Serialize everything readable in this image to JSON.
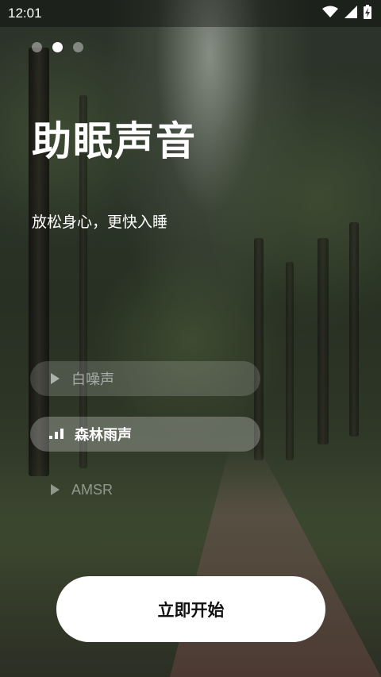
{
  "status_bar": {
    "time": "12:01",
    "icons": [
      "wifi-icon",
      "cell-signal-icon",
      "battery-charging-icon"
    ]
  },
  "pager": {
    "count": 3,
    "active_index": 1
  },
  "hero": {
    "title": "助眠声音",
    "subtitle": "放松身心，更快入睡"
  },
  "sounds": [
    {
      "label": "白噪声",
      "icon": "play-icon",
      "state": "inactive"
    },
    {
      "label": "森林雨声",
      "icon": "equalizer-bars-icon",
      "state": "active"
    },
    {
      "label": "AMSR",
      "icon": "play-icon",
      "state": "faded"
    }
  ],
  "cta": {
    "label": "立即开始"
  },
  "colors": {
    "text": "#ffffff",
    "button_bg": "#ffffff",
    "button_text": "#111111"
  }
}
